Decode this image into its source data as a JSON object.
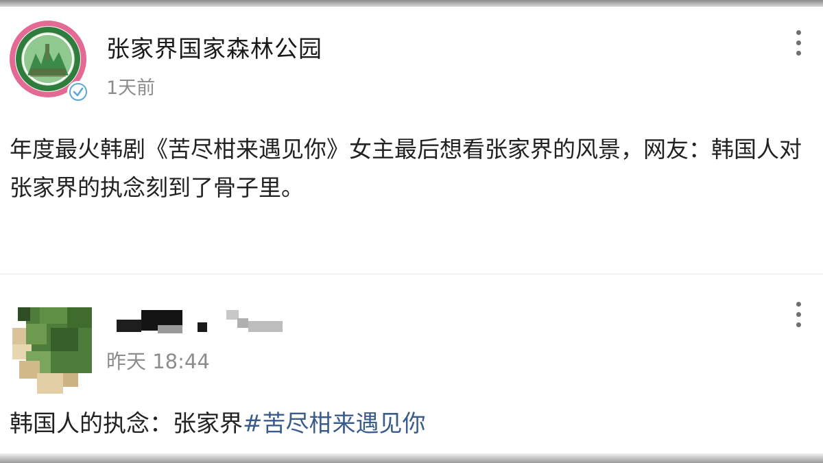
{
  "posts": [
    {
      "author": "张家界国家森林公园",
      "time": "1天前",
      "body": "年度最火韩剧《苦尽柑来遇见你》女主最后想看张家界的风景，网友：韩国人对张家界的执念刻到了骨子里。",
      "avatar_icon": "park-logo-icon",
      "badge_icon": "verified-badge-icon",
      "colors": {
        "avatar_ring": "#e36a92",
        "logo_green": "#3b8a4a"
      }
    },
    {
      "author": "",
      "time": "昨天 18:44",
      "body_prefix": "韩国人的执念：张家界",
      "hashtag": "#苦尽柑来遇见你",
      "avatar_icon": "pixelated-avatar-icon",
      "colors": {
        "hashtag": "#3a5c8c"
      }
    }
  ],
  "more_icon": "more-vertical-icon",
  "colors": {
    "secondary_text": "#8c8c8c",
    "primary_text": "#222222"
  }
}
